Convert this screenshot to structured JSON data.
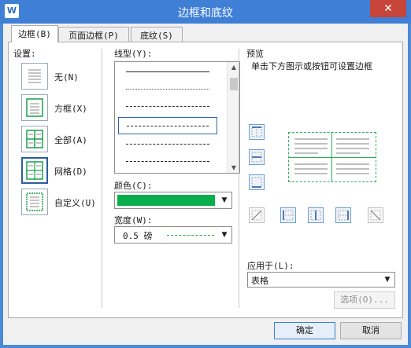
{
  "window": {
    "title": "边框和底纹",
    "app_icon": "W",
    "close_glyph": "✕"
  },
  "tabs": [
    {
      "label": "边框(B)",
      "active": true
    },
    {
      "label": "页面边框(P)",
      "active": false
    },
    {
      "label": "底纹(S)",
      "active": false
    }
  ],
  "settings": {
    "heading": "设置:",
    "items": [
      {
        "label": "无(N)",
        "icon": "none-icon",
        "selected": false
      },
      {
        "label": "方框(X)",
        "icon": "box-icon",
        "selected": false
      },
      {
        "label": "全部(A)",
        "icon": "all-icon",
        "selected": false
      },
      {
        "label": "网格(D)",
        "icon": "grid-icon",
        "selected": true
      },
      {
        "label": "自定义(U)",
        "icon": "custom-icon",
        "selected": false
      }
    ]
  },
  "line_style": {
    "heading": "线型(Y):",
    "styles": [
      "solid",
      "dotted-fine",
      "dashed-small",
      "dashed",
      "dash-dot",
      "dash-dot-dot"
    ],
    "selected_index": 3
  },
  "color": {
    "label": "颜色(C):",
    "value": "#0aad4c"
  },
  "width": {
    "label": "宽度(W):",
    "value": "0.5  磅",
    "line_color": "#2aa84f"
  },
  "preview": {
    "heading": "预览",
    "hint": "单击下方图示或按钮可设置边框",
    "border_color": "#27b058",
    "side_buttons": [
      "border-top-icon",
      "border-inside-horizontal-icon",
      "border-bottom-icon"
    ],
    "bottom_buttons": [
      "diagonal-up-icon",
      "border-left-icon",
      "border-inside-vertical-icon",
      "border-right-icon",
      "diagonal-down-icon"
    ]
  },
  "apply_to": {
    "label": "应用于(L):",
    "value": "表格"
  },
  "buttons": {
    "options": "选项(O)...",
    "ok": "确定",
    "cancel": "取消"
  }
}
